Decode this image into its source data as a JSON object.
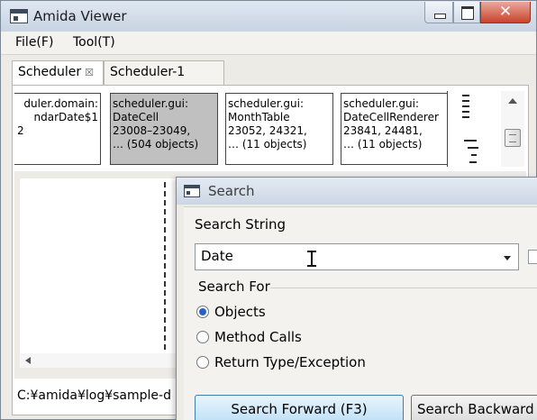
{
  "window": {
    "title": "Amida Viewer",
    "close_glyph": "✕"
  },
  "menu": {
    "file": "File(F)",
    "tool": "Tool(T)"
  },
  "tabs": [
    {
      "label": "Scheduler",
      "close": "☒"
    },
    {
      "label": "Scheduler-1"
    }
  ],
  "cards": [
    {
      "lines": [
        "duler.domain:",
        "ndarDate$1",
        "2"
      ],
      "selected": false
    },
    {
      "lines": [
        "scheduler.gui:",
        "DateCell",
        "23008–23049,",
        "… (504 objects)"
      ],
      "selected": true
    },
    {
      "lines": [
        "scheduler.gui:",
        "MonthTable",
        "23052, 24321,",
        "… (11 objects)"
      ],
      "selected": false
    },
    {
      "lines": [
        "scheduler.gui:",
        "DateCellRenderer",
        "23841, 24481,",
        "… (11 objects)"
      ],
      "selected": false
    }
  ],
  "status": {
    "path": "C:¥amida¥log¥sample-d"
  },
  "dialog": {
    "title": "Search",
    "search_string_label": "Search String",
    "search_value": "Date",
    "search_for_label": "Search For",
    "options": [
      {
        "label": "Objects",
        "checked": true
      },
      {
        "label": "Method Calls",
        "checked": false
      },
      {
        "label": "Return Type/Exception",
        "checked": false
      }
    ],
    "search_forward": "Search Forward (F3)",
    "search_backward": "Search Backward ("
  }
}
